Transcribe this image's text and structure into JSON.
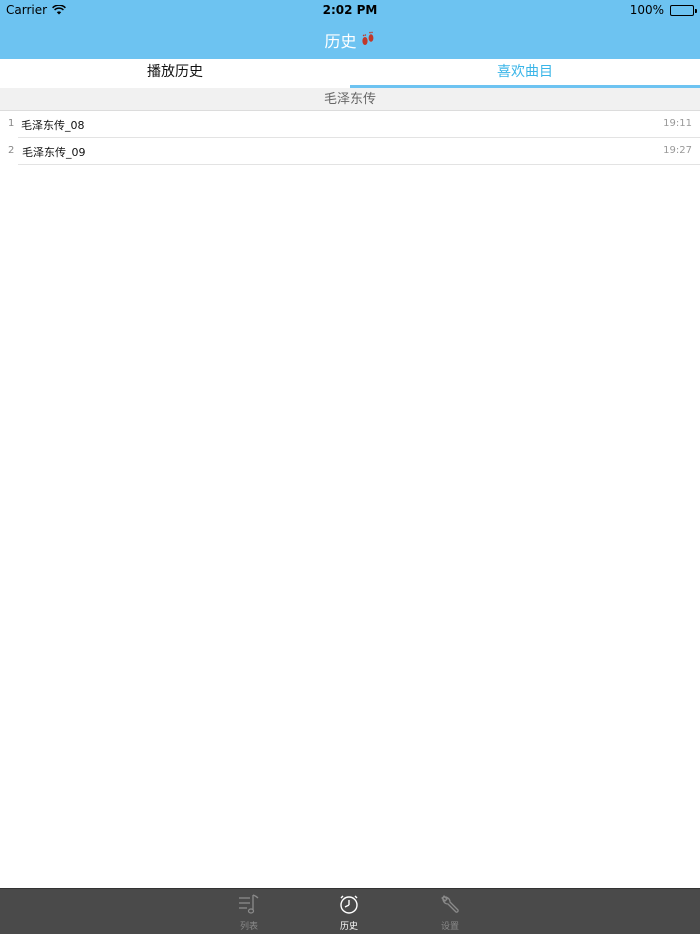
{
  "status_bar": {
    "carrier": "Carrier",
    "time": "2:02 PM",
    "battery": "100%"
  },
  "nav": {
    "title": "历史"
  },
  "segments": {
    "left_label": "播放历史",
    "right_label": "喜欢曲目",
    "selected": "喜欢曲目"
  },
  "section": {
    "header": "毛泽东传"
  },
  "tracks": [
    {
      "index": "1",
      "name": "毛泽东传_08",
      "duration": "19:11"
    },
    {
      "index": "2",
      "name": "毛泽东传_09",
      "duration": "19:27"
    }
  ],
  "tabbar": {
    "items": [
      {
        "label": "列表",
        "icon": "music-list-icon"
      },
      {
        "label": "历史",
        "icon": "clock-icon"
      },
      {
        "label": "设置",
        "icon": "wrench-icon"
      }
    ],
    "selected": "历史"
  },
  "colors": {
    "nav_bg": "#6dc3f1",
    "accent": "#3ab5e8",
    "tabbar_bg": "#4a4a4a",
    "footprint": "#c0392b"
  }
}
